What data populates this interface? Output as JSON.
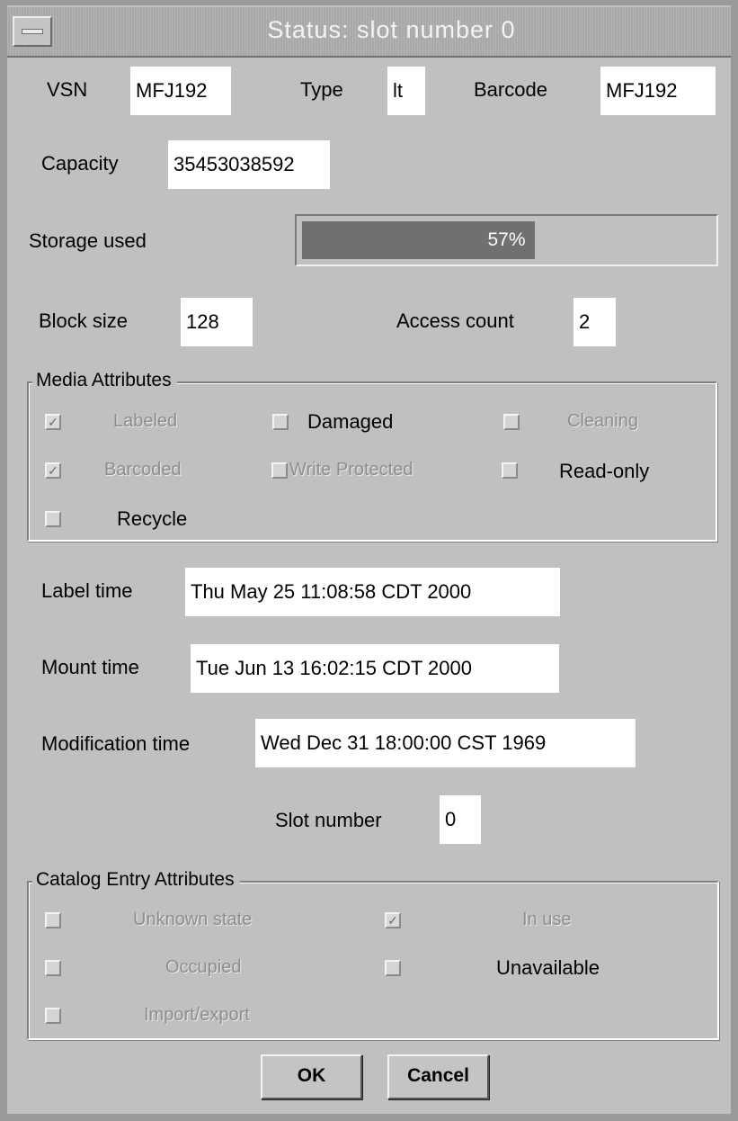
{
  "window": {
    "title": "Status: slot number 0"
  },
  "fields": {
    "vsn_label": "VSN",
    "vsn_value": "MFJ192",
    "type_label": "Type",
    "type_value": "lt",
    "barcode_label": "Barcode",
    "barcode_value": "MFJ192",
    "capacity_label": "Capacity",
    "capacity_value": "35453038592",
    "storage_label": "Storage used",
    "storage_percent_text": "57%",
    "storage_fraction": 0.57,
    "block_size_label": "Block size",
    "block_size_value": "128",
    "access_count_label": "Access count",
    "access_count_value": "2",
    "label_time_label": "Label time",
    "label_time_value": "Thu May 25 11:08:58 CDT 2000",
    "mount_time_label": "Mount time",
    "mount_time_value": "Tue Jun 13 16:02:15 CDT 2000",
    "modification_time_label": "Modification time",
    "modification_time_value": "Wed Dec 31 18:00:00 CST 1969",
    "slot_number_label": "Slot number",
    "slot_number_value": "0"
  },
  "media_attributes": {
    "title": "Media Attributes",
    "items": [
      {
        "label": "Labeled",
        "checked": true,
        "enabled": false
      },
      {
        "label": "Damaged",
        "checked": false,
        "enabled": true
      },
      {
        "label": "Cleaning",
        "checked": false,
        "enabled": false
      },
      {
        "label": "Barcoded",
        "checked": true,
        "enabled": false
      },
      {
        "label": "Write Protected",
        "checked": false,
        "enabled": false
      },
      {
        "label": "Read-only",
        "checked": false,
        "enabled": true
      },
      {
        "label": "Recycle",
        "checked": false,
        "enabled": true
      }
    ]
  },
  "catalog_attributes": {
    "title": "Catalog Entry Attributes",
    "items": [
      {
        "label": "Unknown state",
        "checked": false,
        "enabled": false
      },
      {
        "label": "In use",
        "checked": true,
        "enabled": false
      },
      {
        "label": "Occupied",
        "checked": false,
        "enabled": false
      },
      {
        "label": "Unavailable",
        "checked": false,
        "enabled": true
      },
      {
        "label": "Import/export",
        "checked": false,
        "enabled": false
      }
    ]
  },
  "buttons": {
    "ok": "OK",
    "cancel": "Cancel"
  },
  "icons": {
    "window_menu": "window-menu-icon",
    "check": "checkmark-icon"
  }
}
